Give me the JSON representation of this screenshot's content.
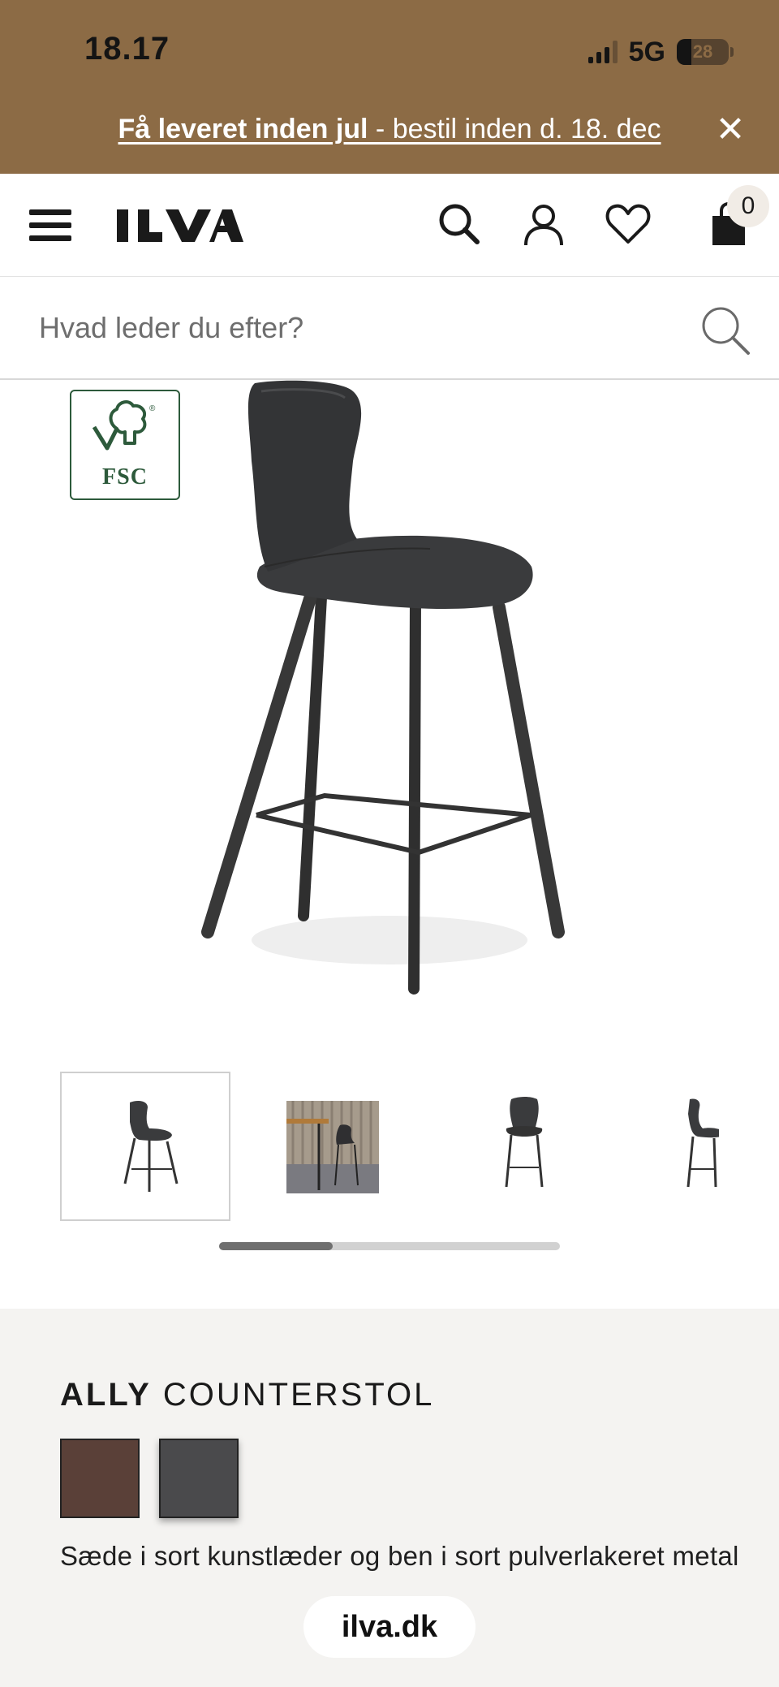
{
  "status_bar": {
    "time": "18.17",
    "network": "5G",
    "battery": "28",
    "battery_level": 0.28
  },
  "promo": {
    "bold_text": "Få leveret inden jul",
    "rest_text": " - bestil inden d. 18. dec",
    "close_icon": "close-icon"
  },
  "header": {
    "logo": "ILVA",
    "icons": [
      "menu-icon",
      "search-icon",
      "account-icon",
      "heart-icon",
      "cart-icon"
    ],
    "cart_count": "0"
  },
  "search": {
    "placeholder": "Hvad leder du efter?"
  },
  "product": {
    "badge": "FSC",
    "thumbnail_count_visible": 4,
    "carousel_position": 0.33,
    "name_bold": "ALLY",
    "name_rest": "COUNTERSTOL",
    "colors": [
      {
        "name": "brown",
        "hex": "#5a4038"
      },
      {
        "name": "black",
        "hex": "#4a4a4c"
      }
    ],
    "selected_color": "black",
    "description": "Sæde i sort kunstlæder og ben i sort pulverlakeret metal"
  },
  "browser": {
    "url": "ilva.dk"
  },
  "theme": {
    "promo_bg": "#8c6b45",
    "info_bg": "#f4f3f1",
    "fsc_green": "#2d5a3b"
  }
}
